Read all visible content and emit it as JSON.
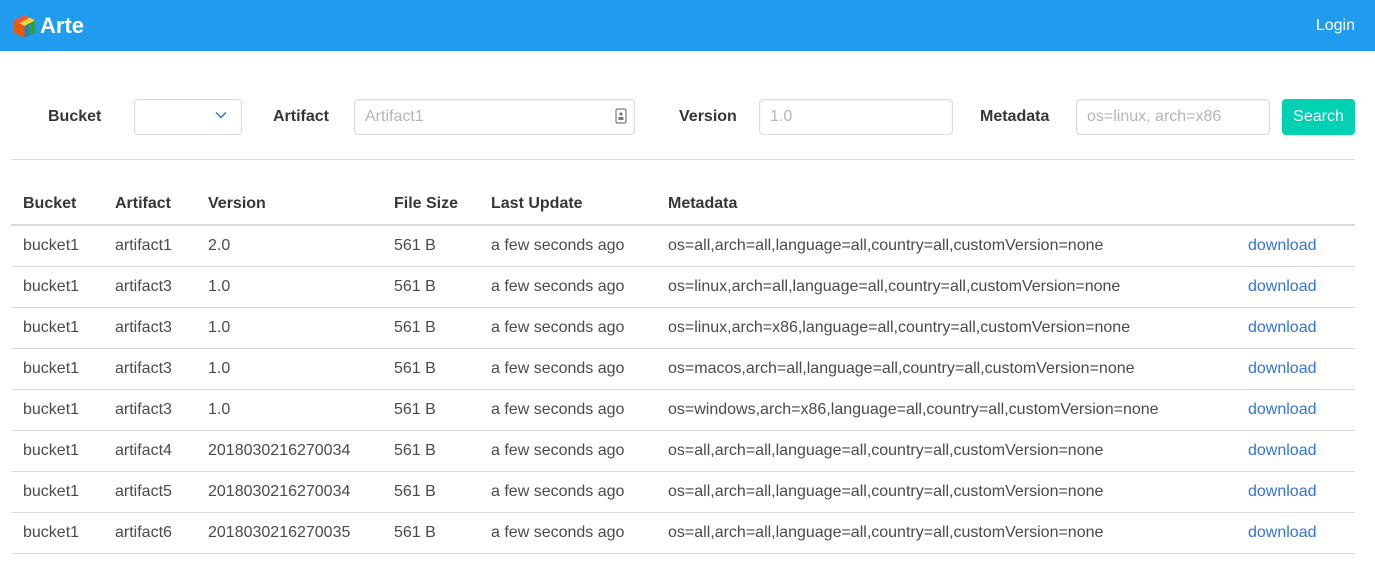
{
  "app": {
    "name": "Arte",
    "logo_icon": "cube-logo-icon"
  },
  "header": {
    "login_label": "Login"
  },
  "search": {
    "bucket_label": "Bucket",
    "bucket_value": "",
    "artifact_label": "Artifact",
    "artifact_placeholder": "Artifact1",
    "version_label": "Version",
    "version_placeholder": "1.0",
    "metadata_label": "Metadata",
    "metadata_placeholder": "os=linux, arch=x86",
    "search_label": "Search"
  },
  "table": {
    "headers": [
      "Bucket",
      "Artifact",
      "Version",
      "File Size",
      "Last Update",
      "Metadata",
      ""
    ],
    "rows": [
      {
        "bucket": "bucket1",
        "artifact": "artifact1",
        "version": "2.0",
        "size": "561 B",
        "updated": "a few seconds ago",
        "metadata": "os=all,arch=all,language=all,country=all,customVersion=none",
        "action": "download"
      },
      {
        "bucket": "bucket1",
        "artifact": "artifact3",
        "version": "1.0",
        "size": "561 B",
        "updated": "a few seconds ago",
        "metadata": "os=linux,arch=all,language=all,country=all,customVersion=none",
        "action": "download"
      },
      {
        "bucket": "bucket1",
        "artifact": "artifact3",
        "version": "1.0",
        "size": "561 B",
        "updated": "a few seconds ago",
        "metadata": "os=linux,arch=x86,language=all,country=all,customVersion=none",
        "action": "download"
      },
      {
        "bucket": "bucket1",
        "artifact": "artifact3",
        "version": "1.0",
        "size": "561 B",
        "updated": "a few seconds ago",
        "metadata": "os=macos,arch=all,language=all,country=all,customVersion=none",
        "action": "download"
      },
      {
        "bucket": "bucket1",
        "artifact": "artifact3",
        "version": "1.0",
        "size": "561 B",
        "updated": "a few seconds ago",
        "metadata": "os=windows,arch=x86,language=all,country=all,customVersion=none",
        "action": "download"
      },
      {
        "bucket": "bucket1",
        "artifact": "artifact4",
        "version": "2018030216270034",
        "size": "561 B",
        "updated": "a few seconds ago",
        "metadata": "os=all,arch=all,language=all,country=all,customVersion=none",
        "action": "download"
      },
      {
        "bucket": "bucket1",
        "artifact": "artifact5",
        "version": "2018030216270034",
        "size": "561 B",
        "updated": "a few seconds ago",
        "metadata": "os=all,arch=all,language=all,country=all,customVersion=none",
        "action": "download"
      },
      {
        "bucket": "bucket1",
        "artifact": "artifact6",
        "version": "2018030216270035",
        "size": "561 B",
        "updated": "a few seconds ago",
        "metadata": "os=all,arch=all,language=all,country=all,customVersion=none",
        "action": "download"
      }
    ]
  },
  "colors": {
    "navbar": "#209cee",
    "search_button": "#00d1b2",
    "link": "#3273dc"
  }
}
